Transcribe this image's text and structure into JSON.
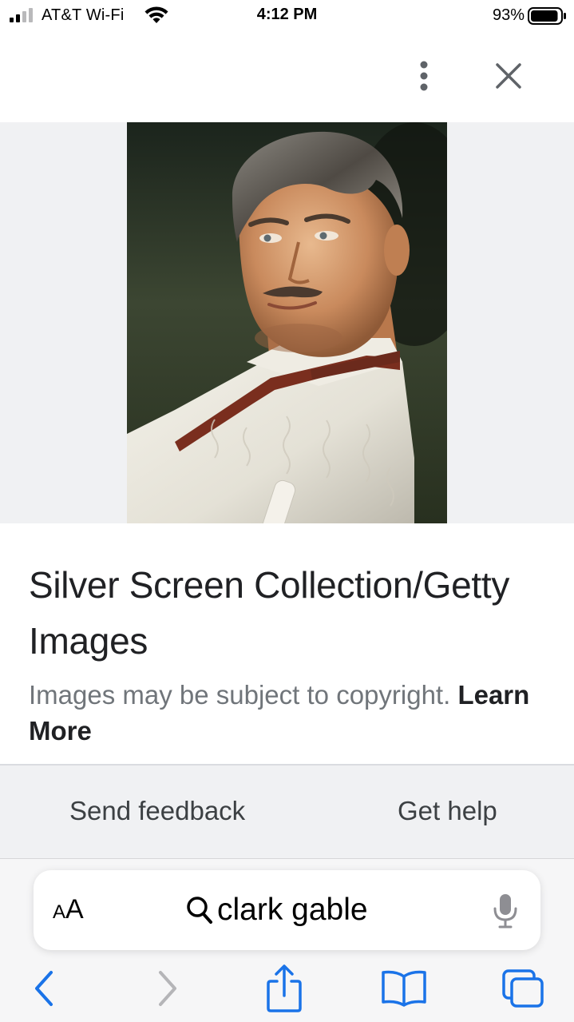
{
  "status_bar": {
    "carrier": "AT&T Wi-Fi",
    "time": "4:12 PM",
    "battery_percent": "93%",
    "battery_level": 0.93
  },
  "top_bar": {
    "more_icon": "vertical-dots-icon",
    "close_icon": "close-icon"
  },
  "image": {
    "alt": "Portrait photograph of a man in a white cable-knit sweater"
  },
  "caption": {
    "title": "Silver Screen Collection/Getty Images",
    "note_prefix": "Images may be subject to copyright.",
    "learn_more": "Learn More"
  },
  "footer": {
    "send_feedback": "Send feedback",
    "get_help": "Get help"
  },
  "safari": {
    "text_size_small": "A",
    "text_size_large": "A",
    "query": "clark gable",
    "accent_color": "#1a73e8",
    "disabled_color": "#b5b5b8"
  }
}
